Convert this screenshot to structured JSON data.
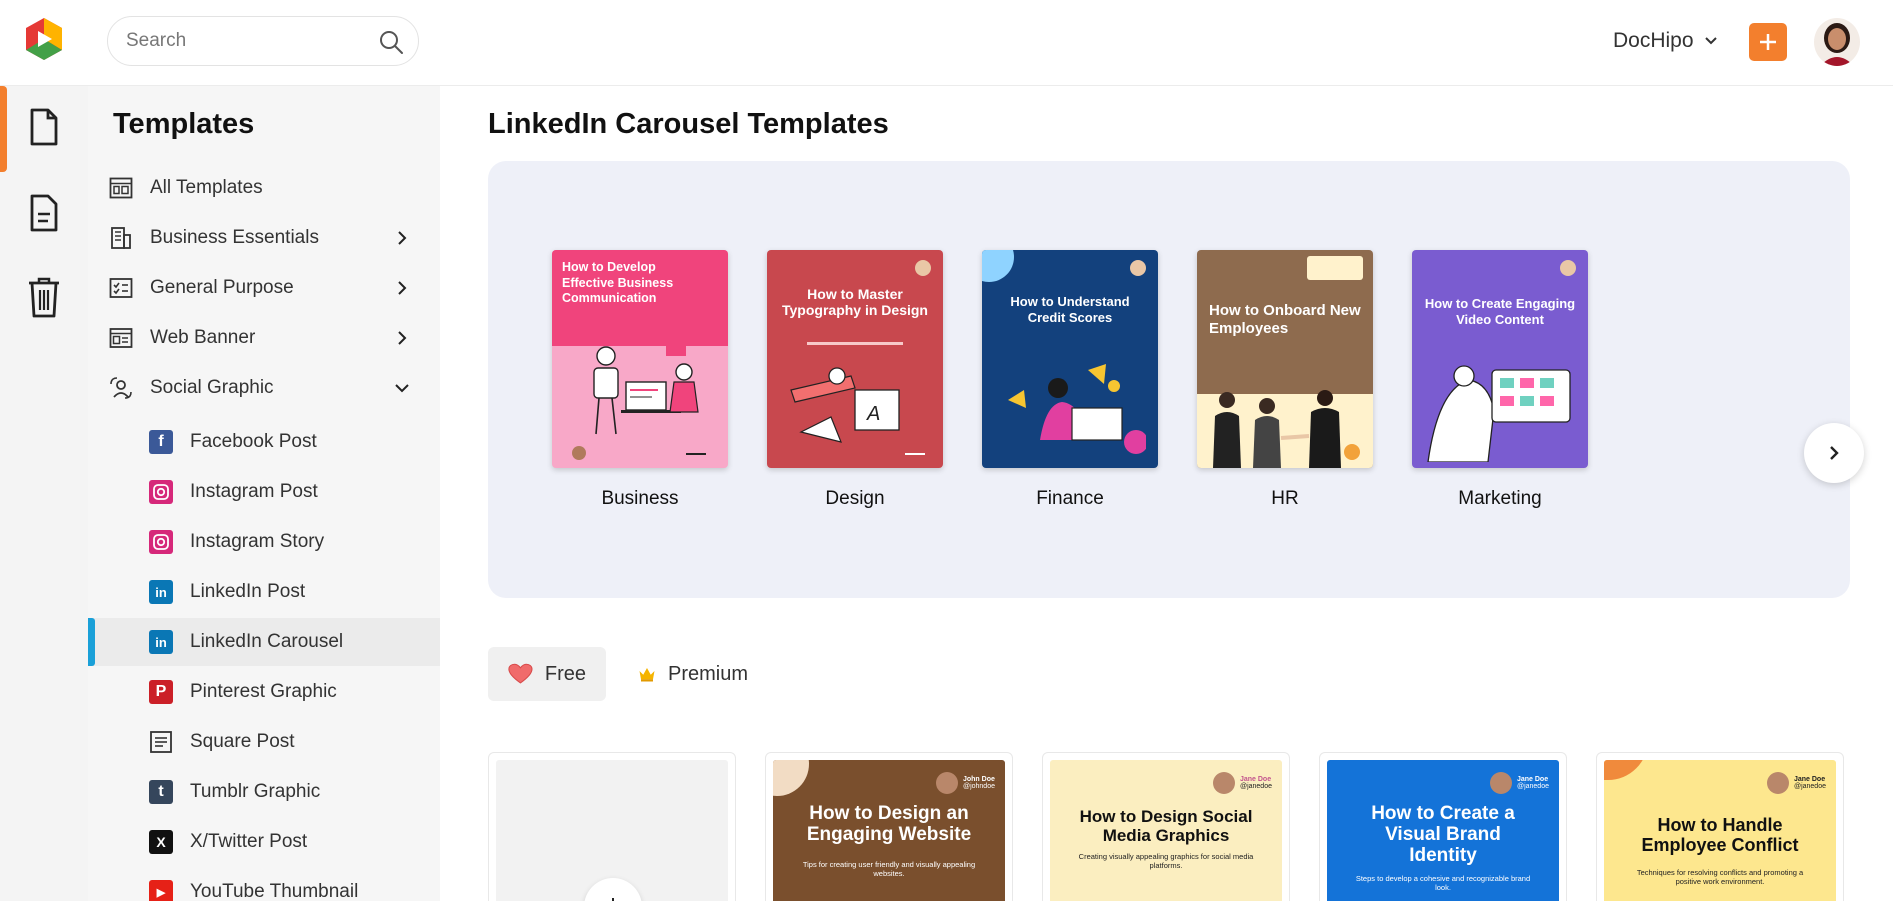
{
  "header": {
    "search_placeholder": "Search",
    "brand_name": "DocHipo",
    "accent_color": "#f37f2d"
  },
  "rail": {
    "items": [
      {
        "icon": "document-icon",
        "active": true
      },
      {
        "icon": "file-text-icon",
        "active": false
      },
      {
        "icon": "trash-icon",
        "active": false
      }
    ]
  },
  "sidebar": {
    "title": "Templates",
    "items": [
      {
        "label": "All Templates",
        "icon": "grid-icon",
        "arrow": ""
      },
      {
        "label": "Business Essentials",
        "icon": "building-icon",
        "arrow": "right"
      },
      {
        "label": "General Purpose",
        "icon": "checklist-icon",
        "arrow": "right"
      },
      {
        "label": "Web Banner",
        "icon": "banner-icon",
        "arrow": "right"
      },
      {
        "label": "Social Graphic",
        "icon": "social-icon",
        "arrow": "down"
      }
    ],
    "sub_items": [
      {
        "label": "Facebook Post",
        "icon": "facebook-icon",
        "color": "#3b5998",
        "glyph": "f"
      },
      {
        "label": "Instagram Post",
        "icon": "instagram-icon",
        "color": "#d6287a",
        "glyph": ""
      },
      {
        "label": "Instagram Story",
        "icon": "instagram-icon",
        "color": "#d6287a",
        "glyph": ""
      },
      {
        "label": "LinkedIn Post",
        "icon": "linkedin-icon",
        "color": "#0a77b5",
        "glyph": "in"
      },
      {
        "label": "LinkedIn Carousel",
        "icon": "linkedin-icon",
        "color": "#0a77b5",
        "glyph": "in",
        "active": true
      },
      {
        "label": "Pinterest Graphic",
        "icon": "pinterest-icon",
        "color": "#cb1f27",
        "glyph": "P"
      },
      {
        "label": "Square Post",
        "icon": "square-post-icon",
        "color": "#ffffff",
        "glyph": ""
      },
      {
        "label": "Tumblr Graphic",
        "icon": "tumblr-icon",
        "color": "#35465c",
        "glyph": "t"
      },
      {
        "label": "X/Twitter Post",
        "icon": "x-icon",
        "color": "#111111",
        "glyph": "X"
      },
      {
        "label": "YouTube Thumbnail",
        "icon": "youtube-icon",
        "color": "#e62117",
        "glyph": "▶"
      }
    ]
  },
  "main": {
    "title": "LinkedIn Carousel Templates",
    "categories": [
      {
        "label": "Business",
        "thumb_title": "How to Develop Effective Business Communication",
        "bg": "#f8a8c8"
      },
      {
        "label": "Design",
        "thumb_title": "How to Master Typography in Design",
        "bg": "#c8484e"
      },
      {
        "label": "Finance",
        "thumb_title": "How to Understand Credit Scores",
        "bg": "#13417d"
      },
      {
        "label": "HR",
        "thumb_title": "How to Onboard New Employees",
        "bg": "#8e6b4e"
      },
      {
        "label": "Marketing",
        "thumb_title": "How to Create Engaging Video Content",
        "bg": "#7a5cd0"
      }
    ],
    "filters": {
      "free": "Free",
      "premium": "Premium"
    },
    "templates": [
      {
        "title": "",
        "author": "",
        "handle": "",
        "sub": "",
        "bg": "#f2f2f2"
      },
      {
        "title": "How to Design an Engaging Website",
        "author": "John Doe",
        "handle": "@johndoe",
        "sub": "Tips for creating user friendly and visually appealing websites.",
        "bg": "#7a4f2d"
      },
      {
        "title": "How to Design Social Media Graphics",
        "author": "Jane Doe",
        "handle": "@janedoe",
        "sub": "Creating visually appealing graphics for social media platforms.",
        "bg": "#fbeec0"
      },
      {
        "title": "How to Create a Visual Brand Identity",
        "author": "Jane Doe",
        "handle": "@janedoe",
        "sub": "Steps to develop a cohesive and recognizable brand look.",
        "bg": "#1473d8"
      },
      {
        "title": "How to Handle Employee Conflict",
        "author": "Jane Doe",
        "handle": "@janedoe",
        "sub": "Techniques for resolving conflicts and promoting a positive work environment.",
        "bg": "#fde78e"
      }
    ]
  }
}
